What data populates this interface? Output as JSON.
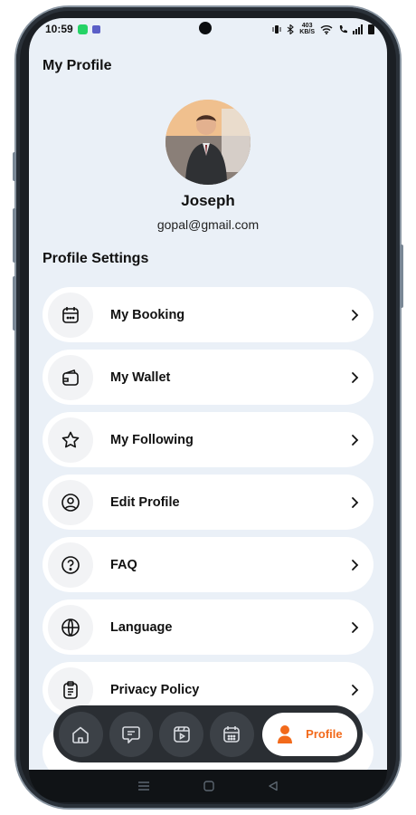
{
  "status_bar": {
    "time": "10:59",
    "network_speed_top": "403",
    "network_speed_bottom": "KB/S"
  },
  "header": {
    "title": "My Profile"
  },
  "user": {
    "name": "Joseph",
    "email": "gopal@gmail.com"
  },
  "settings": {
    "title": "Profile Settings",
    "items": [
      {
        "label": "My Booking",
        "icon": "calendar-icon"
      },
      {
        "label": "My Wallet",
        "icon": "wallet-icon"
      },
      {
        "label": "My Following",
        "icon": "star-icon"
      },
      {
        "label": "Edit Profile",
        "icon": "user-circle-icon"
      },
      {
        "label": "FAQ",
        "icon": "question-icon"
      },
      {
        "label": "Language",
        "icon": "globe-icon"
      },
      {
        "label": "Privacy Policy",
        "icon": "clipboard-icon"
      }
    ]
  },
  "tab_bar": {
    "tabs": [
      {
        "icon": "home-icon"
      },
      {
        "icon": "chat-icon"
      },
      {
        "icon": "video-icon"
      },
      {
        "icon": "calendar-icon"
      }
    ],
    "active": {
      "label": "Profile",
      "icon": "user-icon",
      "color": "#f26a1b"
    }
  },
  "colors": {
    "background": "#eaf0f7",
    "accent": "#f26a1b",
    "tab_bar": "#2a2e33"
  }
}
